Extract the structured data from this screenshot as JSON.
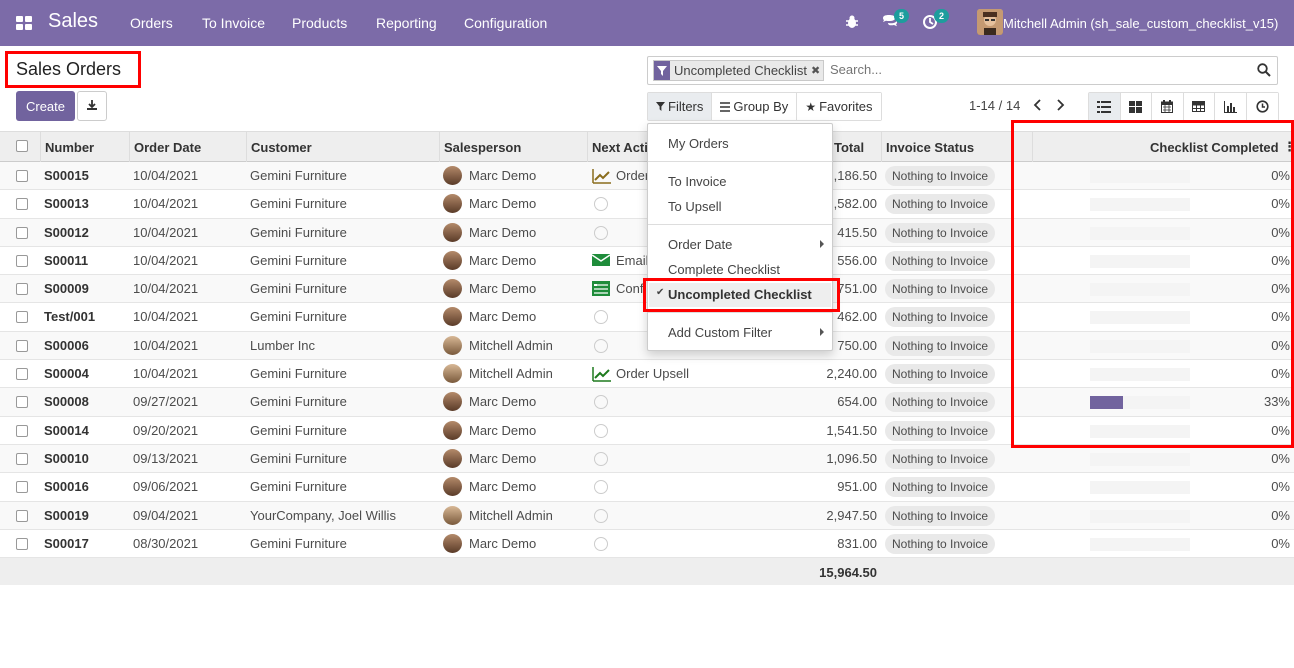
{
  "navbar": {
    "brand": "Sales",
    "menu": [
      "Orders",
      "To Invoice",
      "Products",
      "Reporting",
      "Configuration"
    ],
    "messages_count": "5",
    "activities_count": "2",
    "user": "Mitchell Admin (sh_sale_custom_checklist_v15)"
  },
  "control": {
    "title": "Sales Orders",
    "create_label": "Create",
    "search_facet": "Uncompleted Checklist",
    "search_placeholder": "Search...",
    "filters_label": "Filters",
    "groupby_label": "Group By",
    "favorites_label": "Favorites",
    "pager": "1-14 / 14"
  },
  "filters_menu": {
    "my_orders": "My Orders",
    "to_invoice": "To Invoice",
    "to_upsell": "To Upsell",
    "order_date": "Order Date",
    "complete_checklist": "Complete Checklist",
    "uncompleted_checklist": "Uncompleted Checklist",
    "add_custom_filter": "Add Custom Filter"
  },
  "table": {
    "headers": {
      "number": "Number",
      "order_date": "Order Date",
      "customer": "Customer",
      "salesperson": "Salesperson",
      "next_activity": "Next Acti",
      "total": "Total",
      "invoice_status": "Invoice Status",
      "checklist": "Checklist Completed"
    },
    "rows": [
      {
        "number": "S00015",
        "date": "10/04/2021",
        "customer": "Gemini Furniture",
        "sales": "Marc Demo",
        "act": "Order",
        "act_icon": "upsell",
        "total": ",186.50",
        "status": "Nothing to Invoice",
        "pct": "0%",
        "fill": 0
      },
      {
        "number": "S00013",
        "date": "10/04/2021",
        "customer": "Gemini Furniture",
        "sales": "Marc Demo",
        "act": "",
        "act_icon": "clock",
        "total": ",582.00",
        "status": "Nothing to Invoice",
        "pct": "0%",
        "fill": 0
      },
      {
        "number": "S00012",
        "date": "10/04/2021",
        "customer": "Gemini Furniture",
        "sales": "Marc Demo",
        "act": "",
        "act_icon": "clock",
        "total": "415.50",
        "status": "Nothing to Invoice",
        "pct": "0%",
        "fill": 0
      },
      {
        "number": "S00011",
        "date": "10/04/2021",
        "customer": "Gemini Furniture",
        "sales": "Marc Demo",
        "act": "Email",
        "act_icon": "email",
        "total": "556.00",
        "status": "Nothing to Invoice",
        "pct": "0%",
        "fill": 0
      },
      {
        "number": "S00009",
        "date": "10/04/2021",
        "customer": "Gemini Furniture",
        "sales": "Marc Demo",
        "act": "Conf",
        "act_icon": "form",
        "total": "751.00",
        "status": "Nothing to Invoice",
        "pct": "0%",
        "fill": 0
      },
      {
        "number": "Test/001",
        "date": "10/04/2021",
        "customer": "Gemini Furniture",
        "sales": "Marc Demo",
        "act": "",
        "act_icon": "clock",
        "total": "462.00",
        "status": "Nothing to Invoice",
        "pct": "0%",
        "fill": 0
      },
      {
        "number": "S00006",
        "date": "10/04/2021",
        "customer": "Lumber Inc",
        "sales": "Mitchell Admin",
        "act": "",
        "act_icon": "clock",
        "total": "750.00",
        "status": "Nothing to Invoice",
        "pct": "0%",
        "fill": 0
      },
      {
        "number": "S00004",
        "date": "10/04/2021",
        "customer": "Gemini Furniture",
        "sales": "Mitchell Admin",
        "act": "Order Upsell",
        "act_icon": "upsell-green",
        "total": "2,240.00",
        "status": "Nothing to Invoice",
        "pct": "0%",
        "fill": 0
      },
      {
        "number": "S00008",
        "date": "09/27/2021",
        "customer": "Gemini Furniture",
        "sales": "Marc Demo",
        "act": "",
        "act_icon": "clock",
        "total": "654.00",
        "status": "Nothing to Invoice",
        "pct": "33%",
        "fill": 0.33
      },
      {
        "number": "S00014",
        "date": "09/20/2021",
        "customer": "Gemini Furniture",
        "sales": "Marc Demo",
        "act": "",
        "act_icon": "clock",
        "total": "1,541.50",
        "status": "Nothing to Invoice",
        "pct": "0%",
        "fill": 0
      },
      {
        "number": "S00010",
        "date": "09/13/2021",
        "customer": "Gemini Furniture",
        "sales": "Marc Demo",
        "act": "",
        "act_icon": "clock",
        "total": "1,096.50",
        "status": "Nothing to Invoice",
        "pct": "0%",
        "fill": 0
      },
      {
        "number": "S00016",
        "date": "09/06/2021",
        "customer": "Gemini Furniture",
        "sales": "Marc Demo",
        "act": "",
        "act_icon": "clock",
        "total": "951.00",
        "status": "Nothing to Invoice",
        "pct": "0%",
        "fill": 0
      },
      {
        "number": "S00019",
        "date": "09/04/2021",
        "customer": "YourCompany, Joel Willis",
        "sales": "Mitchell Admin",
        "act": "",
        "act_icon": "clock",
        "total": "2,947.50",
        "status": "Nothing to Invoice",
        "pct": "0%",
        "fill": 0
      },
      {
        "number": "S00017",
        "date": "08/30/2021",
        "customer": "Gemini Furniture",
        "sales": "Marc Demo",
        "act": "",
        "act_icon": "clock",
        "total": "831.00",
        "status": "Nothing to Invoice",
        "pct": "0%",
        "fill": 0
      }
    ],
    "footer_total": "15,964.50"
  },
  "colors": {
    "brand": "#7c6ba8",
    "primary": "#71639e",
    "highlight": "#ff0000"
  }
}
